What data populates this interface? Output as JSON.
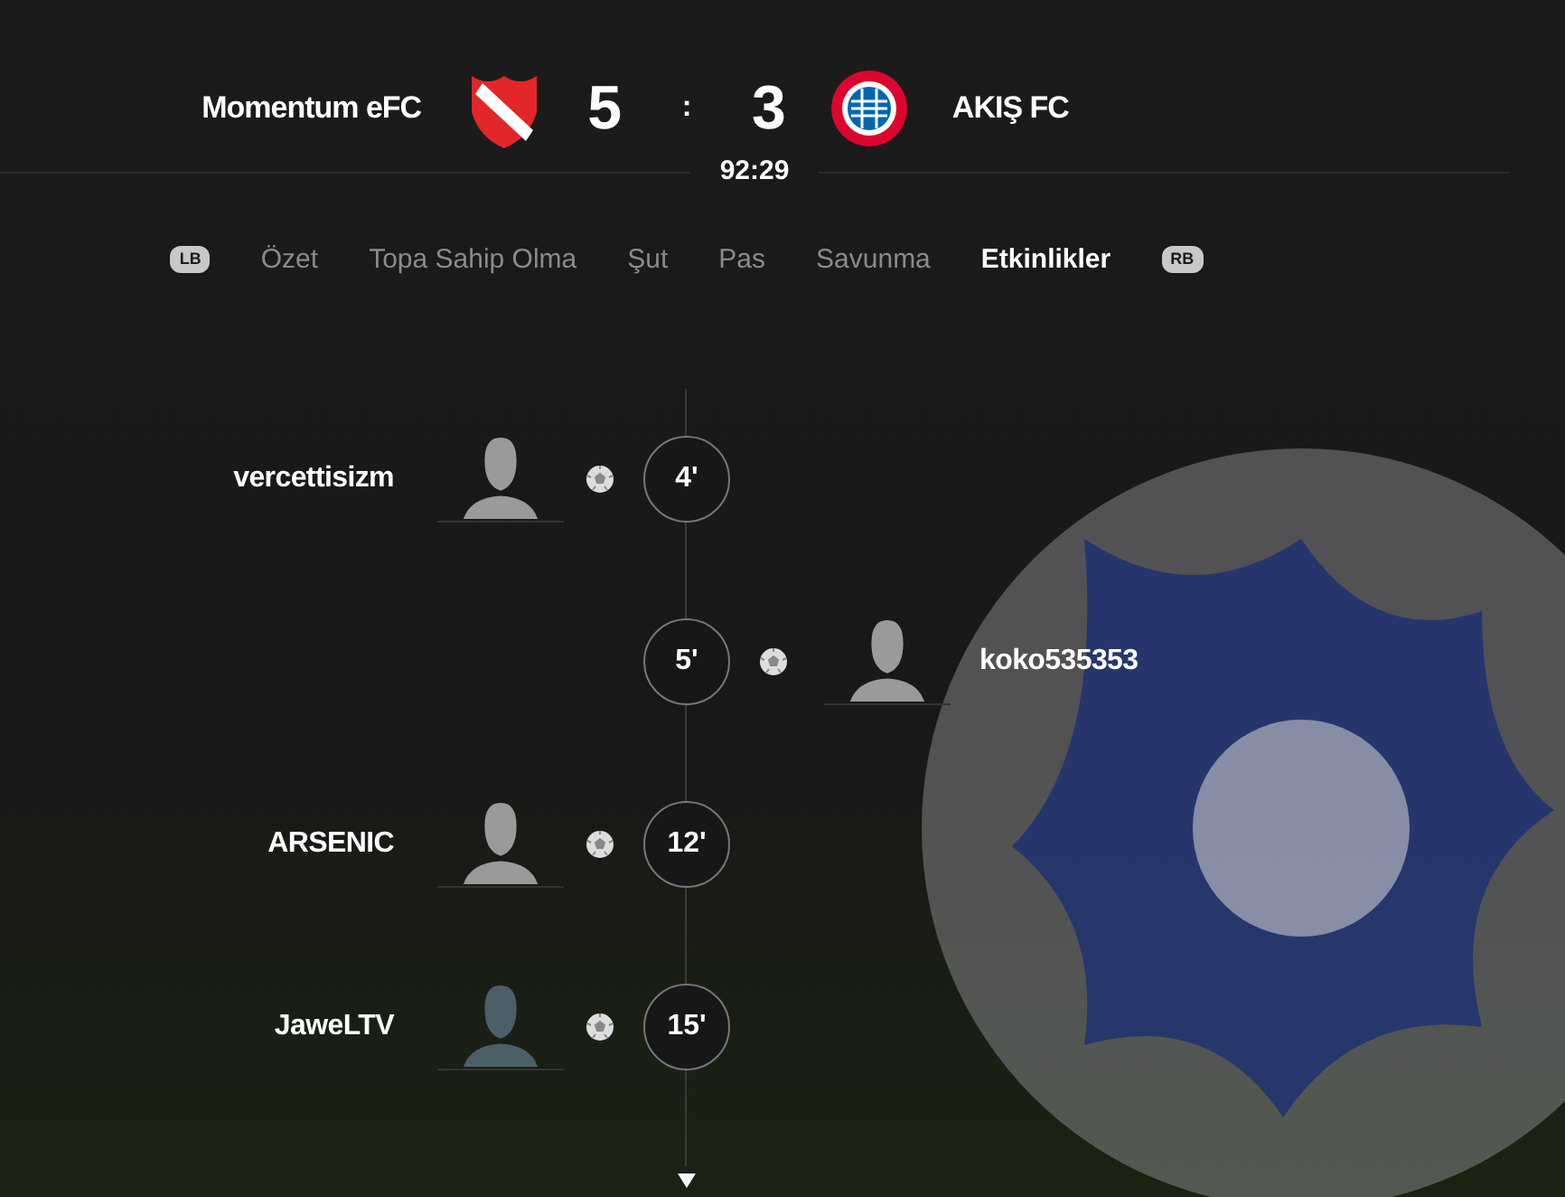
{
  "match": {
    "home": {
      "name": "Momentum eFC",
      "score": "5"
    },
    "separator": ":",
    "away": {
      "name": "AKIŞ FC",
      "score": "3"
    },
    "clock": "92:29"
  },
  "tabs": {
    "prev_key": "LB",
    "next_key": "RB",
    "items": [
      {
        "label": "Özet",
        "selected": false
      },
      {
        "label": "Topa Sahip Olma",
        "selected": false
      },
      {
        "label": "Şut",
        "selected": false
      },
      {
        "label": "Pas",
        "selected": false
      },
      {
        "label": "Savunma",
        "selected": false
      },
      {
        "label": "Etkinlikler",
        "selected": true
      }
    ]
  },
  "events": [
    {
      "away": false,
      "kind": "goal",
      "player": "vercettisizm",
      "minute": "4'",
      "color": "#9a9a9a"
    },
    {
      "away": true,
      "kind": "goal",
      "player": "koko535353",
      "minute": "5'",
      "color": "#9a9a9a"
    },
    {
      "away": false,
      "kind": "goal",
      "player": "ARSENIC",
      "minute": "12'",
      "color": "#9a9a9a"
    },
    {
      "away": false,
      "kind": "goal",
      "player": "JaweLTV",
      "minute": "15'",
      "color": "#4a5f68"
    }
  ]
}
